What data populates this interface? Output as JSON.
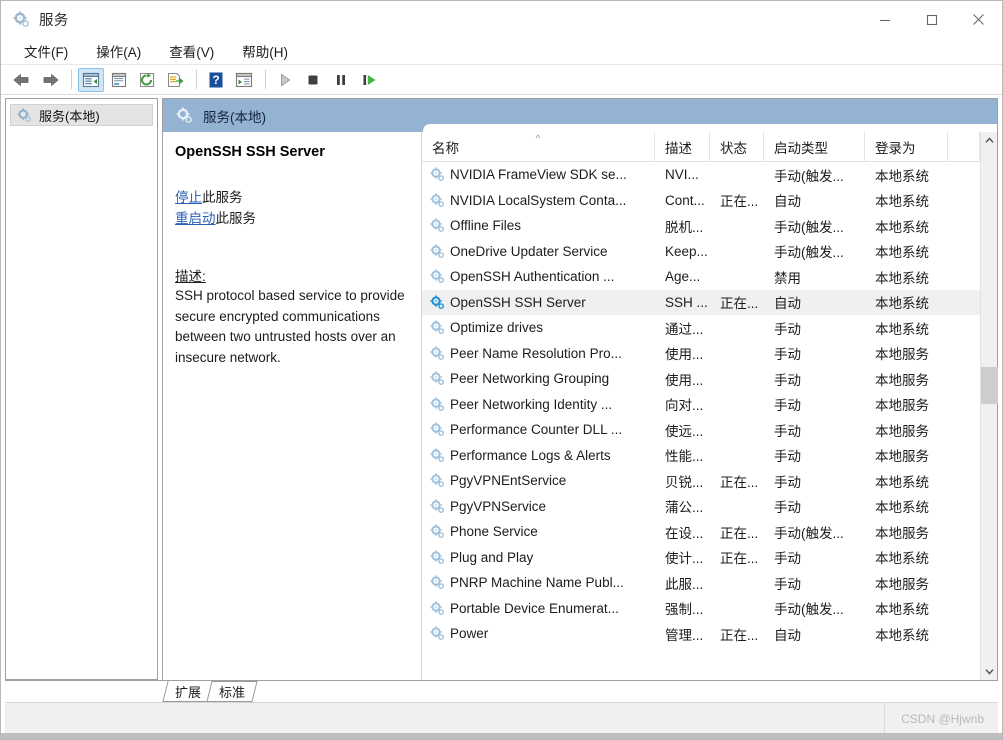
{
  "window": {
    "title": "服务",
    "icon": "services-gear-icon",
    "minimize_label": "—",
    "maximize_label": "□",
    "close_label": "✕"
  },
  "menu": {
    "items": [
      {
        "label": "文件(F)",
        "name": "menu-file"
      },
      {
        "label": "操作(A)",
        "name": "menu-action"
      },
      {
        "label": "查看(V)",
        "name": "menu-view"
      },
      {
        "label": "帮助(H)",
        "name": "menu-help"
      }
    ]
  },
  "toolbar": {
    "buttons": [
      {
        "name": "back-button",
        "icon": "arrow-left-icon"
      },
      {
        "name": "forward-button",
        "icon": "arrow-right-icon"
      },
      {
        "name": "show-hide-tree-button",
        "icon": "console-tree-icon"
      },
      {
        "name": "properties-button",
        "icon": "properties-icon"
      },
      {
        "name": "refresh-button",
        "icon": "refresh-icon"
      },
      {
        "name": "export-list-button",
        "icon": "export-list-icon"
      },
      {
        "name": "help-button",
        "icon": "help-question-icon"
      },
      {
        "name": "show-action-pane-button",
        "icon": "action-pane-icon"
      },
      {
        "name": "start-service-button",
        "icon": "play-icon"
      },
      {
        "name": "stop-service-button",
        "icon": "stop-icon"
      },
      {
        "name": "pause-service-button",
        "icon": "pause-icon"
      },
      {
        "name": "restart-service-button",
        "icon": "restart-icon"
      }
    ]
  },
  "tree": {
    "root": {
      "label": "服务(本地)",
      "icon": "services-gear-icon"
    }
  },
  "pane": {
    "header": {
      "label": "服务(本地)",
      "icon": "services-gear-icon"
    }
  },
  "details": {
    "service_title": "OpenSSH SSH Server",
    "actions": [
      {
        "link": "停止",
        "suffix": "此服务",
        "name": "stop-service-link"
      },
      {
        "link": "重启动",
        "suffix": "此服务",
        "name": "restart-service-link"
      }
    ],
    "description_label": "描述:",
    "description_text": "SSH protocol based service to provide secure encrypted communications between two untrusted hosts over an insecure network."
  },
  "list": {
    "columns": [
      {
        "label": "名称",
        "name": "column-name",
        "sorted": "asc"
      },
      {
        "label": "描述",
        "name": "column-description"
      },
      {
        "label": "状态",
        "name": "column-status"
      },
      {
        "label": "启动类型",
        "name": "column-startup-type"
      },
      {
        "label": "登录为",
        "name": "column-log-on-as"
      }
    ],
    "sort_indicator": "^",
    "rows": [
      {
        "name": "NVIDIA FrameView SDK se...",
        "desc": "NVI...",
        "status": "",
        "startup": "手动(触发...",
        "logon": "本地系统",
        "selected": false
      },
      {
        "name": "NVIDIA LocalSystem Conta...",
        "desc": "Cont...",
        "status": "正在...",
        "startup": "自动",
        "logon": "本地系统",
        "selected": false
      },
      {
        "name": "Offline Files",
        "desc": "脱机...",
        "status": "",
        "startup": "手动(触发...",
        "logon": "本地系统",
        "selected": false
      },
      {
        "name": "OneDrive Updater Service",
        "desc": "Keep...",
        "status": "",
        "startup": "手动(触发...",
        "logon": "本地系统",
        "selected": false
      },
      {
        "name": "OpenSSH Authentication ...",
        "desc": "Age...",
        "status": "",
        "startup": "禁用",
        "logon": "本地系统",
        "selected": false
      },
      {
        "name": "OpenSSH SSH Server",
        "desc": "SSH ...",
        "status": "正在...",
        "startup": "自动",
        "logon": "本地系统",
        "selected": true
      },
      {
        "name": "Optimize drives",
        "desc": "通过...",
        "status": "",
        "startup": "手动",
        "logon": "本地系统",
        "selected": false
      },
      {
        "name": "Peer Name Resolution Pro...",
        "desc": "使用...",
        "status": "",
        "startup": "手动",
        "logon": "本地服务",
        "selected": false
      },
      {
        "name": "Peer Networking Grouping",
        "desc": "使用...",
        "status": "",
        "startup": "手动",
        "logon": "本地服务",
        "selected": false
      },
      {
        "name": "Peer Networking Identity ...",
        "desc": "向对...",
        "status": "",
        "startup": "手动",
        "logon": "本地服务",
        "selected": false
      },
      {
        "name": "Performance Counter DLL ...",
        "desc": "使远...",
        "status": "",
        "startup": "手动",
        "logon": "本地服务",
        "selected": false
      },
      {
        "name": "Performance Logs & Alerts",
        "desc": "性能...",
        "status": "",
        "startup": "手动",
        "logon": "本地服务",
        "selected": false
      },
      {
        "name": "PgyVPNEntService",
        "desc": "贝锐...",
        "status": "正在...",
        "startup": "手动",
        "logon": "本地系统",
        "selected": false
      },
      {
        "name": "PgyVPNService",
        "desc": "蒲公...",
        "status": "",
        "startup": "手动",
        "logon": "本地系统",
        "selected": false
      },
      {
        "name": "Phone Service",
        "desc": "在设...",
        "status": "正在...",
        "startup": "手动(触发...",
        "logon": "本地服务",
        "selected": false
      },
      {
        "name": "Plug and Play",
        "desc": "使计...",
        "status": "正在...",
        "startup": "手动",
        "logon": "本地系统",
        "selected": false
      },
      {
        "name": "PNRP Machine Name Publ...",
        "desc": "此服...",
        "status": "",
        "startup": "手动",
        "logon": "本地服务",
        "selected": false
      },
      {
        "name": "Portable Device Enumerat...",
        "desc": "强制...",
        "status": "",
        "startup": "手动(触发...",
        "logon": "本地系统",
        "selected": false
      },
      {
        "name": "Power",
        "desc": "管理...",
        "status": "正在...",
        "startup": "自动",
        "logon": "本地系统",
        "selected": false
      }
    ]
  },
  "tabs": [
    {
      "label": "扩展",
      "name": "tab-extended",
      "selected": false
    },
    {
      "label": "标准",
      "name": "tab-standard",
      "selected": true
    }
  ],
  "statusbar": {
    "watermark": "CSDN @Hjwnb"
  },
  "colors": {
    "pane_header_blue": "#94b2d2",
    "selected_row": "#f0f0f0",
    "link_blue": "#2b5fb5",
    "gear_blue": "#1f8fd6"
  }
}
